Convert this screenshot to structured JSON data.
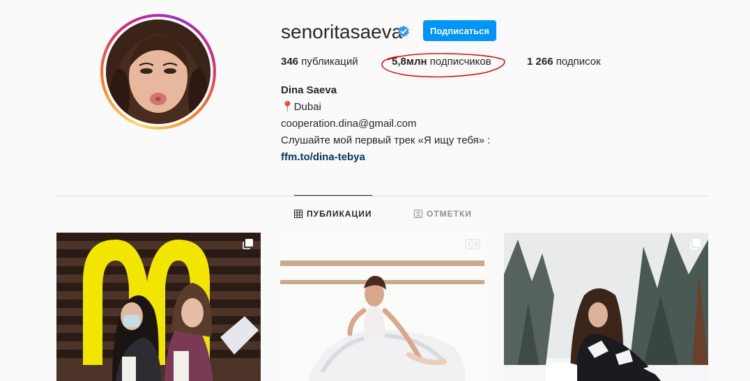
{
  "profile": {
    "username": "senoritasaeva",
    "follow_label": "Подписаться",
    "stats": {
      "posts_count": "346",
      "posts_label": "публикаций",
      "followers_count": "5,8млн",
      "followers_label": "подписчиков",
      "following_count": "1 266",
      "following_label": "подписок"
    },
    "bio": {
      "name": "Dina Saeva",
      "location": "📍Dubai",
      "email": "cooperation.dina@gmail.com",
      "text": "Слушайте мой первый трек «Я ищу тебя» :",
      "link": "ffm.to/dina-tebya"
    }
  },
  "tabs": [
    {
      "label": "ПУБЛИКАЦИИ",
      "icon": "grid-icon",
      "active": true
    },
    {
      "label": "ОТМЕТКИ",
      "icon": "tag-person-icon",
      "active": false
    }
  ],
  "posts": [
    {
      "badge": "carousel-icon"
    },
    {
      "badge": "video-icon"
    },
    {
      "badge": "carousel-icon"
    }
  ],
  "colors": {
    "accent": "#0095f6",
    "link": "#00376b",
    "annotation": "#d40000",
    "verified": "#3897f0"
  }
}
